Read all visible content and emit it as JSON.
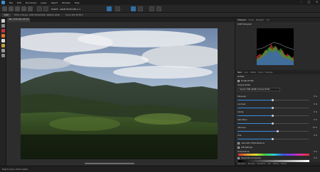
{
  "menu": {
    "items": [
      "File",
      "Edit",
      "Document",
      "Layer",
      "Select",
      "Window",
      "Help"
    ]
  },
  "toolbar": {
    "color_label": "RGB/8",
    "profile_label": "sRGB IEC61966-2.1"
  },
  "contextbar": {
    "doc_label": "RAW",
    "info": "DCIM_7145.jpg, 13MP (4000x3000), RGBA/8, sRGB",
    "camera": "Canon EOS 5D Mk II"
  },
  "document": {
    "tab_label": "IMG_7145.CR2 (25.0%)"
  },
  "panels": {
    "top_tabs": [
      "Histogram",
      "Scope",
      "Navigator",
      "Info"
    ],
    "active_top_tab": "Histogram",
    "raw_layer": "RGB Histogram",
    "bottom_tabs": [
      "Basic",
      "Lens",
      "Details",
      "Tones",
      "Overlays"
    ],
    "active_bottom_tab": "Basic",
    "profile": "Profiles",
    "profile_check": "Enable Profile",
    "output_profile": "Output Profile",
    "profile_value": "Generic RGB (sRGB) Camera Profile",
    "exposure_label": "Exposure",
    "exposure_value": "0 %",
    "contrast_label": "Contrast",
    "contrast_value": "0 %",
    "clarity_label": "Clarity",
    "clarity_value": "0 %",
    "saturation_label": "Saturation",
    "saturation_value": "0 %",
    "vibrance_label": "Vibrance",
    "vibrance_value": "13 %",
    "hue_label": "Hue",
    "hue_value": "0 %",
    "auto_wb": "Automatic White Balance",
    "wb_label": "WB Settings",
    "wb_temp": "Temperature",
    "wb_temp_value": "0 %",
    "gray_label": "Greyscale Conversion",
    "gray_value": "0 %",
    "bottom_tabs2": [
      "Navigator",
      "Brushes",
      "Transform",
      "Info",
      "History",
      "Blocks"
    ]
  },
  "status": {
    "text": "Drag to move, click to select."
  },
  "colors": {
    "accent": "#3b8be0"
  }
}
